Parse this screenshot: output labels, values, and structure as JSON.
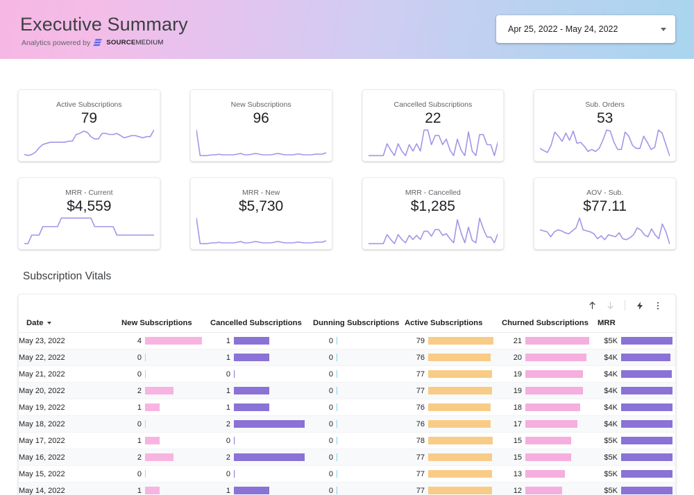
{
  "header": {
    "title": "Executive Summary",
    "subtitle_prefix": "Analytics powered by",
    "logo_bold": "SOURCE",
    "logo_light": "MEDIUM",
    "date_range": "Apr 25, 2022 - May 24, 2022",
    "caret_icon": "chevron-down-icon",
    "gradient_from": "#f7b6e4",
    "gradient_to": "#a9d5ef"
  },
  "scorecards": [
    {
      "label": "Active Subscriptions",
      "value": "79",
      "spark": [
        14,
        13,
        14,
        16,
        20,
        23,
        24,
        25,
        25,
        25,
        25,
        25,
        26,
        26,
        32,
        33,
        35,
        34,
        30,
        28,
        28,
        33,
        33,
        32,
        32,
        33,
        31,
        29,
        30,
        31,
        31,
        30,
        29,
        30,
        30,
        36
      ]
    },
    {
      "label": "New Subscriptions",
      "value": "96",
      "spark": [
        44,
        8,
        8,
        8,
        9,
        9,
        10,
        9,
        9,
        9,
        9,
        10,
        11,
        9,
        9,
        10,
        11,
        10,
        9,
        9,
        9,
        10,
        11,
        10,
        9,
        9,
        9,
        10,
        10,
        9,
        9,
        9,
        10,
        10,
        10,
        12
      ]
    },
    {
      "label": "Cancelled Subscriptions",
      "value": "22",
      "spark": [
        4,
        4,
        4,
        4,
        4,
        17,
        10,
        4,
        17,
        9,
        4,
        16,
        9,
        17,
        9,
        32,
        32,
        16,
        26,
        26,
        16,
        22,
        10,
        4,
        22,
        10,
        4,
        30,
        9,
        4,
        27,
        27,
        16,
        16,
        4,
        20
      ]
    },
    {
      "label": "Sub. Orders",
      "value": "53",
      "spark": [
        10,
        8,
        6,
        13,
        26,
        22,
        17,
        25,
        18,
        27,
        15,
        16,
        12,
        7,
        9,
        7,
        10,
        18,
        28,
        27,
        16,
        9,
        9,
        26,
        22,
        13,
        10,
        10,
        22,
        16,
        9,
        11,
        28,
        25,
        14,
        3
      ]
    },
    {
      "label": "MRR - Current",
      "value": "$4,559",
      "spark": [
        11,
        11,
        12,
        12,
        12,
        13,
        13,
        13,
        13,
        13,
        14,
        14,
        14,
        14,
        14,
        14,
        14,
        14,
        14,
        13,
        13,
        13,
        13,
        13,
        13,
        12,
        12,
        12,
        12,
        12,
        12,
        12,
        12,
        12,
        12,
        12
      ]
    },
    {
      "label": "MRR - New",
      "value": "$5,730",
      "spark": [
        44,
        8,
        8,
        8,
        9,
        9,
        10,
        9,
        9,
        9,
        9,
        10,
        11,
        9,
        9,
        10,
        11,
        10,
        9,
        9,
        9,
        10,
        11,
        10,
        9,
        9,
        9,
        10,
        10,
        9,
        9,
        9,
        10,
        10,
        10,
        12
      ]
    },
    {
      "label": "MRR - Cancelled",
      "value": "$1,285",
      "spark": [
        4,
        4,
        4,
        4,
        4,
        15,
        9,
        4,
        15,
        9,
        5,
        14,
        9,
        14,
        9,
        19,
        19,
        13,
        21,
        21,
        14,
        16,
        10,
        5,
        33,
        17,
        5,
        24,
        8,
        5,
        35,
        22,
        12,
        12,
        5,
        17
      ]
    },
    {
      "label": "AOV - Sub.",
      "value": "$77.11",
      "spark": [
        18,
        17,
        16,
        11,
        16,
        18,
        17,
        15,
        14,
        17,
        20,
        30,
        18,
        17,
        16,
        14,
        9,
        12,
        8,
        13,
        12,
        11,
        15,
        9,
        8,
        10,
        13,
        20,
        18,
        13,
        11,
        19,
        13,
        9,
        24,
        16,
        4
      ]
    }
  ],
  "table": {
    "title": "Subscription Vitals",
    "toolbar": [
      {
        "name": "sort-asc-icon",
        "state": "active"
      },
      {
        "name": "sort-desc-icon",
        "state": "disabled"
      },
      {
        "name": "divider",
        "state": "static"
      },
      {
        "name": "explore-bolt-icon",
        "state": "active"
      },
      {
        "name": "more-vert-icon",
        "state": "active"
      }
    ],
    "sort_column": "Date",
    "sort_direction": "desc",
    "columns": [
      {
        "label": "Date",
        "type": "text"
      },
      {
        "label": "New Subscriptions",
        "type": "bar",
        "color": "#f8b4e0",
        "max": 4
      },
      {
        "label": "Cancelled Subscriptions",
        "type": "bar",
        "color": "#8a72d6",
        "max": 2
      },
      {
        "label": "Dunning Subscriptions",
        "type": "bar",
        "color": "#7fd1e8",
        "max": 2
      },
      {
        "label": "Active Subscriptions",
        "type": "bar",
        "color": "#f8cc87",
        "max": 79
      },
      {
        "label": "Churned Subscriptions",
        "type": "bar",
        "color": "#f5aede",
        "max": 21
      },
      {
        "label": "MRR",
        "type": "bar",
        "color": "#8a72d6",
        "max": 5000
      }
    ],
    "rows": [
      {
        "date": "May 23, 2022",
        "new": 4,
        "new_label": "4",
        "cancelled": 1,
        "cancelled_label": "1",
        "dunning": 0,
        "dunning_label": "0",
        "active": 79,
        "active_label": "79",
        "churned": 21,
        "churned_label": "21",
        "mrr": 5000,
        "mrr_label": "$5K"
      },
      {
        "date": "May 22, 2022",
        "new": 0,
        "new_label": "0",
        "cancelled": 1,
        "cancelled_label": "1",
        "dunning": 0,
        "dunning_label": "0",
        "active": 76,
        "active_label": "76",
        "churned": 20,
        "churned_label": "20",
        "mrr": 4800,
        "mrr_label": "$4K"
      },
      {
        "date": "May 21, 2022",
        "new": 0,
        "new_label": "0",
        "cancelled": 0,
        "cancelled_label": "0",
        "dunning": 0,
        "dunning_label": "0",
        "active": 77,
        "active_label": "77",
        "churned": 19,
        "churned_label": "19",
        "mrr": 4900,
        "mrr_label": "$4K"
      },
      {
        "date": "May 20, 2022",
        "new": 2,
        "new_label": "2",
        "cancelled": 1,
        "cancelled_label": "1",
        "dunning": 0,
        "dunning_label": "0",
        "active": 77,
        "active_label": "77",
        "churned": 19,
        "churned_label": "19",
        "mrr": 5000,
        "mrr_label": "$4K"
      },
      {
        "date": "May 19, 2022",
        "new": 1,
        "new_label": "1",
        "cancelled": 1,
        "cancelled_label": "1",
        "dunning": 0,
        "dunning_label": "0",
        "active": 76,
        "active_label": "76",
        "churned": 18,
        "churned_label": "18",
        "mrr": 5000,
        "mrr_label": "$4K"
      },
      {
        "date": "May 18, 2022",
        "new": 0,
        "new_label": "0",
        "cancelled": 2,
        "cancelled_label": "2",
        "dunning": 0,
        "dunning_label": "0",
        "active": 76,
        "active_label": "76",
        "churned": 17,
        "churned_label": "17",
        "mrr": 5000,
        "mrr_label": "$4K"
      },
      {
        "date": "May 17, 2022",
        "new": 1,
        "new_label": "1",
        "cancelled": 0,
        "cancelled_label": "0",
        "dunning": 0,
        "dunning_label": "0",
        "active": 78,
        "active_label": "78",
        "churned": 15,
        "churned_label": "15",
        "mrr": 5000,
        "mrr_label": "$5K"
      },
      {
        "date": "May 16, 2022",
        "new": 2,
        "new_label": "2",
        "cancelled": 2,
        "cancelled_label": "2",
        "dunning": 0,
        "dunning_label": "0",
        "active": 77,
        "active_label": "77",
        "churned": 15,
        "churned_label": "15",
        "mrr": 5000,
        "mrr_label": "$5K"
      },
      {
        "date": "May 15, 2022",
        "new": 0,
        "new_label": "0",
        "cancelled": 0,
        "cancelled_label": "0",
        "dunning": 0,
        "dunning_label": "0",
        "active": 77,
        "active_label": "77",
        "churned": 13,
        "churned_label": "13",
        "mrr": 5000,
        "mrr_label": "$5K"
      },
      {
        "date": "May 14, 2022",
        "new": 1,
        "new_label": "1",
        "cancelled": 1,
        "cancelled_label": "1",
        "dunning": 0,
        "dunning_label": "0",
        "active": 77,
        "active_label": "77",
        "churned": 12,
        "churned_label": "12",
        "mrr": 5000,
        "mrr_label": "$5K"
      }
    ]
  }
}
